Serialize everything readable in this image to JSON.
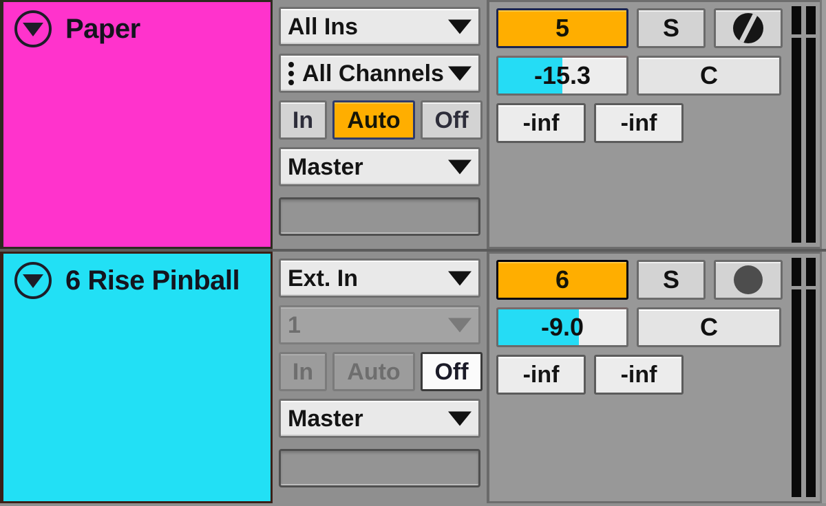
{
  "app": {
    "name": "ableton-live-track-headers",
    "colors": {
      "track1_color": "#ff33cc",
      "track2_color": "#22e0f5",
      "activator_orange": "#ffae00",
      "volume_fill_cyan": "#25dcf5",
      "panel_gray": "#8f8f8f"
    }
  },
  "tracks": [
    {
      "name": "Paper",
      "fold_icon": "triangle-down-icon",
      "io": {
        "input_type": "All Ins",
        "input_channel": "All Channels",
        "channel_grip_icon": "vertical-dots-icon",
        "monitor": {
          "in_label": "In",
          "auto_label": "Auto",
          "off_label": "Off",
          "selected": "Auto",
          "disabled": false
        },
        "output_type": "Master",
        "output_channel": ""
      },
      "mixer": {
        "activator_label": "5",
        "solo_label": "S",
        "arm_icon": "midi-arm-circle-slash-icon",
        "volume_value": "-15.3",
        "volume_percent": 50,
        "crossfade_label": "C",
        "send_a": "-inf",
        "send_b": "-inf"
      }
    },
    {
      "name": "6 Rise Pinball",
      "fold_icon": "triangle-down-icon",
      "io": {
        "input_type": "Ext. In",
        "input_channel": "1",
        "channel_grip_icon": "none",
        "monitor": {
          "in_label": "In",
          "auto_label": "Auto",
          "off_label": "Off",
          "selected": "Off",
          "disabled": true
        },
        "output_type": "Master",
        "output_channel": ""
      },
      "mixer": {
        "activator_label": "6",
        "solo_label": "S",
        "arm_icon": "audio-arm-circle-icon",
        "volume_value": "-9.0",
        "volume_percent": 63,
        "crossfade_label": "C",
        "send_a": "-inf",
        "send_b": "-inf"
      }
    }
  ]
}
